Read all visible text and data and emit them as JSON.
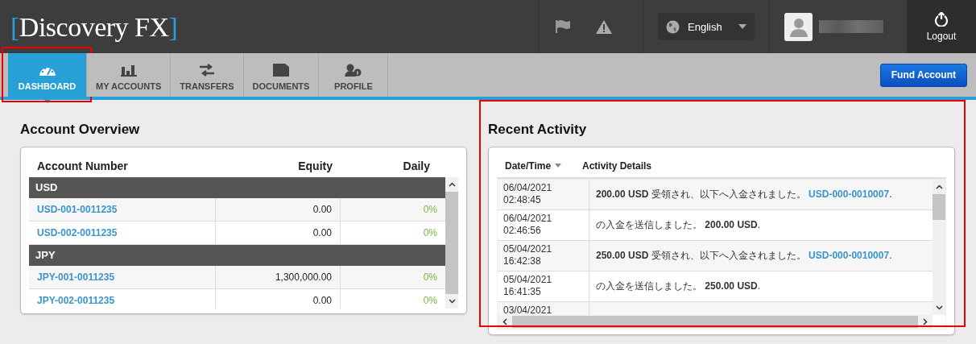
{
  "header": {
    "logo": {
      "open": "[",
      "name": "Discovery FX",
      "close": "]"
    },
    "language": "English",
    "logout": "Logout"
  },
  "tabs": [
    {
      "label": "DASHBOARD",
      "selected": true,
      "highlighted": true,
      "kind": "gauge"
    },
    {
      "label": "MY ACCOUNTS",
      "selected": false,
      "highlighted": false,
      "kind": "bars"
    },
    {
      "label": "TRANSFERS",
      "selected": false,
      "highlighted": false,
      "kind": "arrows"
    },
    {
      "label": "DOCUMENTS",
      "selected": false,
      "highlighted": false,
      "kind": "folder"
    },
    {
      "label": "PROFILE",
      "selected": false,
      "highlighted": false,
      "kind": "user"
    }
  ],
  "fund_button": "Fund Account",
  "account_overview": {
    "title": "Account Overview",
    "columns": [
      "Account Number",
      "Equity",
      "Daily"
    ],
    "groups": [
      {
        "name": "USD",
        "rows": [
          {
            "account": "USD-001-0011235",
            "equity": "0.00",
            "daily": "0%"
          },
          {
            "account": "USD-002-0011235",
            "equity": "0.00",
            "daily": "0%"
          }
        ]
      },
      {
        "name": "JPY",
        "rows": [
          {
            "account": "JPY-001-0011235",
            "equity": "1,300,000.00",
            "daily": "0%"
          },
          {
            "account": "JPY-002-0011235",
            "equity": "0.00",
            "daily": "0%"
          }
        ]
      }
    ]
  },
  "recent_activity": {
    "title": "Recent Activity",
    "highlighted": true,
    "columns": [
      "Date/Time",
      "Activity Details"
    ],
    "rows": [
      {
        "date": "06/04/2021",
        "time": "02:48:45",
        "details": "**200.00 USD** 受領され、以下へ入金されました。 ",
        "link": "USD-000-0010007",
        "end": "."
      },
      {
        "date": "06/04/2021",
        "time": "02:46:56",
        "details": "の入金を送信しました。 **200.00 USD**."
      },
      {
        "date": "05/04/2021",
        "time": "16:42:38",
        "details": "**250.00 USD** 受領され、以下へ入金されました。 ",
        "link": "USD-000-0010007",
        "end": "."
      },
      {
        "date": "05/04/2021",
        "time": "16:41:35",
        "details": "の入金を送信しました。 **250.00 USD**."
      },
      {
        "date": "03/04/2021"
      }
    ]
  }
}
